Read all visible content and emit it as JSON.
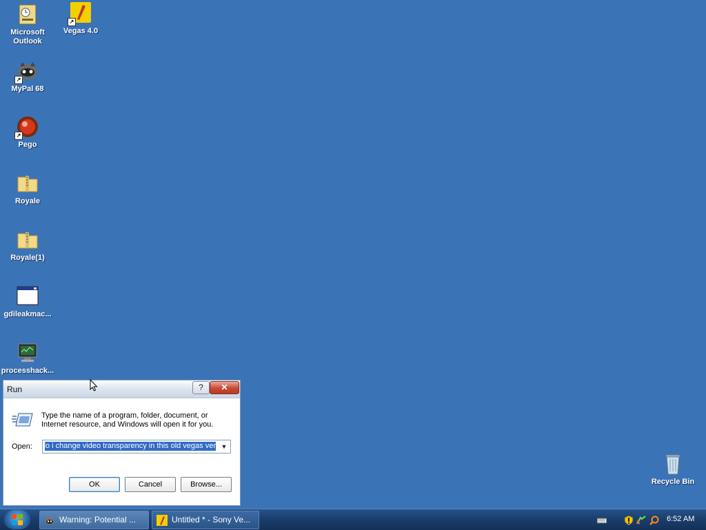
{
  "desktop": {
    "icons": [
      {
        "label": "Microsoft Outlook",
        "icon": "outlook-icon"
      },
      {
        "label": "Vegas 4.0",
        "icon": "vegas-icon"
      },
      {
        "label": "MyPal 68",
        "icon": "mypal-icon"
      },
      {
        "label": "Pego",
        "icon": "pego-icon"
      },
      {
        "label": "Royale",
        "icon": "zip-folder-icon"
      },
      {
        "label": "Royale(1)",
        "icon": "zip-folder-icon"
      },
      {
        "label": "gdileakmac...",
        "icon": "window-app-icon"
      },
      {
        "label": "processhack...",
        "icon": "monitor-app-icon"
      },
      {
        "label": "Recycle Bin",
        "icon": "recycle-bin-icon"
      }
    ],
    "background_color": "#3b73b7"
  },
  "run_dialog": {
    "title": "Run",
    "help_label": "?",
    "close_label": "✕",
    "description": "Type the name of a program, folder, document, or Internet resource, and Windows will open it for you.",
    "open_label": "Open:",
    "open_value": "how do i change video transparency in this old vegas ver",
    "ok_label": "OK",
    "cancel_label": "Cancel",
    "browse_label": "Browse..."
  },
  "taskbar": {
    "tasks": [
      {
        "label": "Warning: Potential ...",
        "icon": "warning-app-icon"
      },
      {
        "label": "Untitled * - Sony Ve...",
        "icon": "vegas-icon"
      }
    ],
    "tray_icons": [
      "keyboard-icon",
      "shield-icon",
      "network-icon",
      "search-icon"
    ],
    "clock": "6:52 AM"
  }
}
